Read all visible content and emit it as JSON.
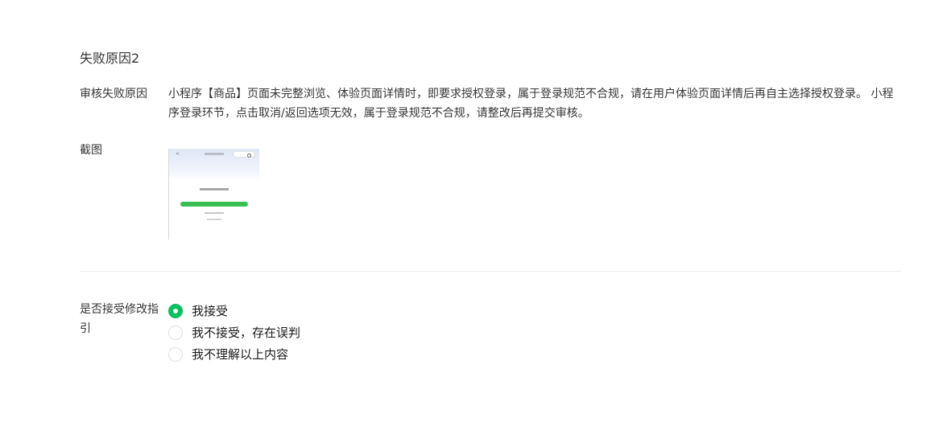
{
  "section": {
    "title": "失败原因2"
  },
  "reason": {
    "label": "审核失败原因",
    "text": "小程序【商品】页面未完整浏览、体验页面详情时，即要求授权登录，属于登录规范不合规，请在用户体验页面详情后再自主选择授权登录。 小程序登录环节，点击取消/返回选项无效，属于登录规范不合规，请整改后再提交审核。"
  },
  "screenshot": {
    "label": "截图",
    "back_glyph": "<"
  },
  "guidance": {
    "label": "是否接受修改指引",
    "selected_index": 0,
    "options": [
      {
        "label": "我接受",
        "checked": true
      },
      {
        "label": "我不接受，存在误判",
        "checked": false
      },
      {
        "label": "我不理解以上内容",
        "checked": false
      }
    ]
  },
  "colors": {
    "accent_green": "#07c160",
    "text": "#353535",
    "divider": "#ececec"
  }
}
